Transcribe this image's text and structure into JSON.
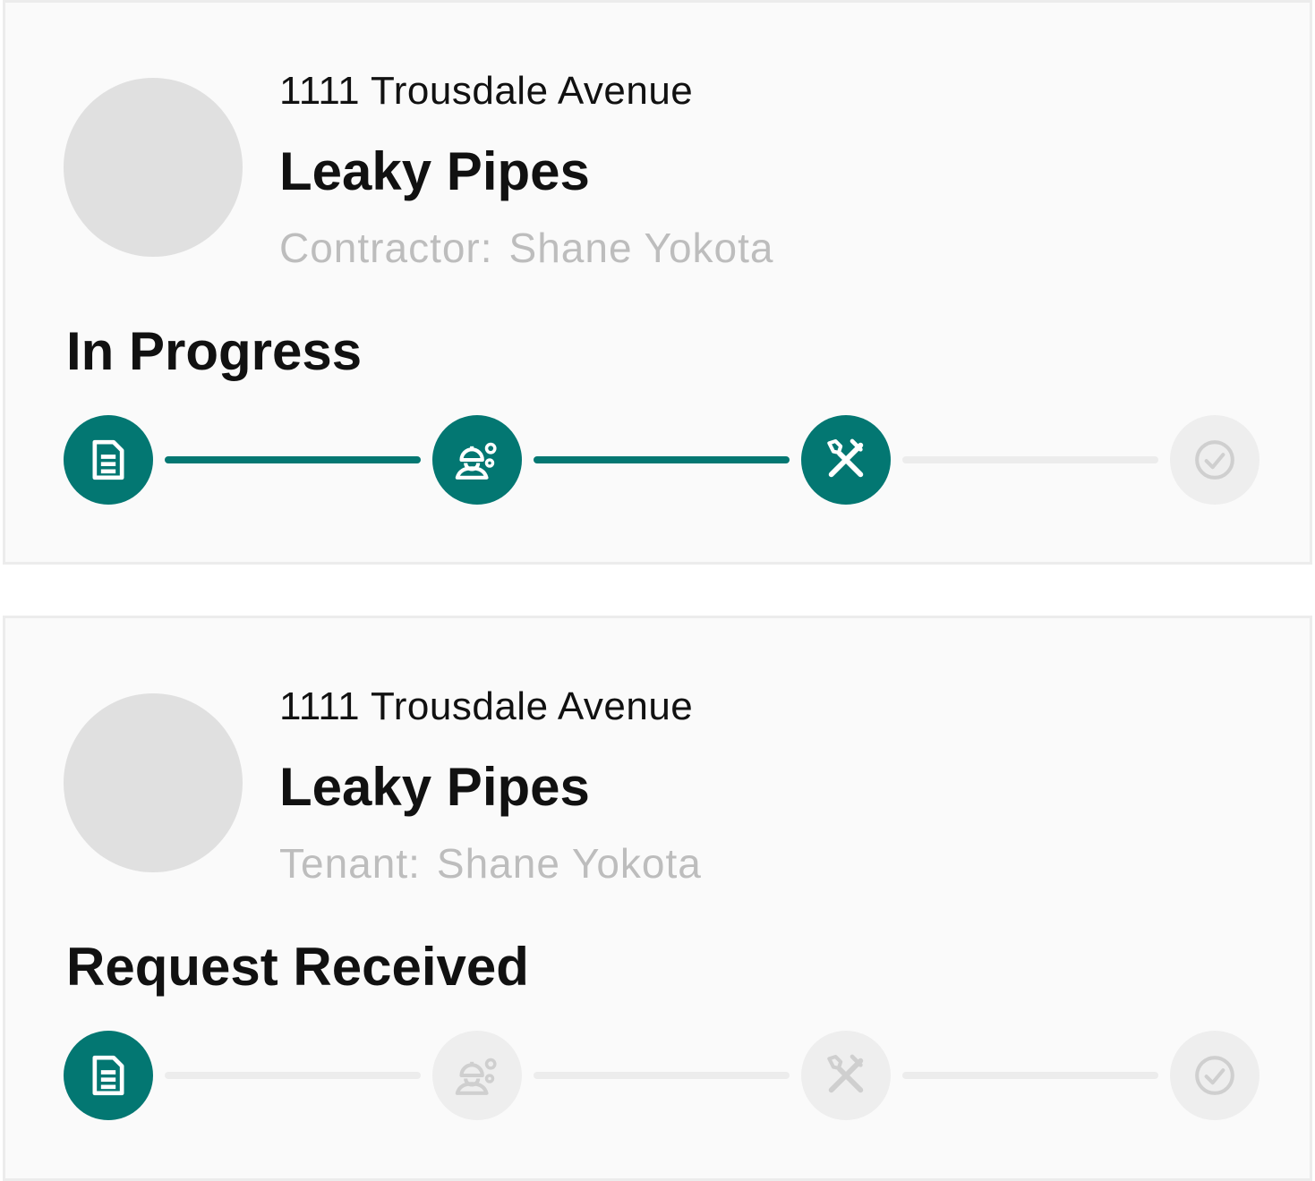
{
  "colors": {
    "accent": "#037772",
    "inactive_step": "#eeeeee",
    "inactive_icon": "#cfcfcf",
    "muted_text": "#bdbdbd",
    "card_background": "#fafafa",
    "avatar_placeholder": "#e0e0e0"
  },
  "cards": [
    {
      "address": "1111 Trousdale Avenue",
      "title": "Leaky Pipes",
      "person_role": "Contractor:",
      "person_name": "Shane Yokota",
      "status": "In Progress",
      "steps": [
        {
          "icon": "document-icon",
          "completed": true
        },
        {
          "icon": "worker-gears-icon",
          "completed": true
        },
        {
          "icon": "tools-icon",
          "completed": true
        },
        {
          "icon": "check-circle-icon",
          "completed": false
        }
      ],
      "connectors": [
        true,
        true,
        false
      ]
    },
    {
      "address": "1111 Trousdale Avenue",
      "title": "Leaky Pipes",
      "person_role": "Tenant:",
      "person_name": "Shane Yokota",
      "status": "Request Received",
      "steps": [
        {
          "icon": "document-icon",
          "completed": true
        },
        {
          "icon": "worker-gears-icon",
          "completed": false
        },
        {
          "icon": "tools-icon",
          "completed": false
        },
        {
          "icon": "check-circle-icon",
          "completed": false
        }
      ],
      "connectors": [
        false,
        false,
        false
      ]
    }
  ]
}
